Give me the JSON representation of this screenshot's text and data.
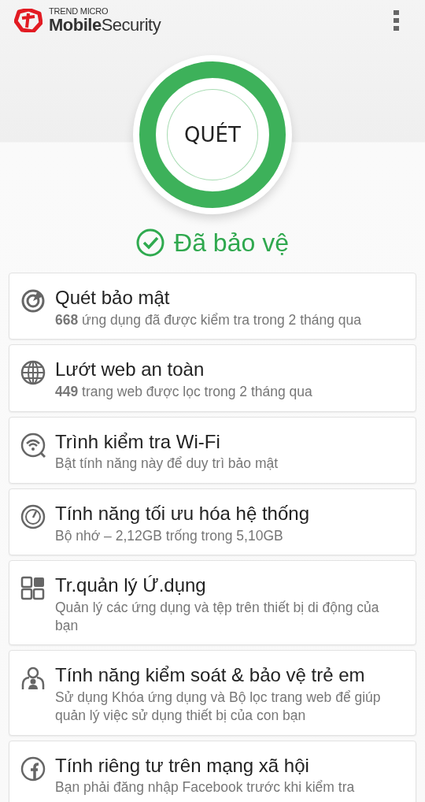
{
  "header": {
    "brand": "TREND MICRO",
    "product": "**Mobile**Security"
  },
  "scan_button": {
    "label": "QUÉT"
  },
  "status": {
    "text": "Đã bảo vệ",
    "protected": true
  },
  "features": [
    {
      "kind": "radar",
      "title": "Quét bảo mật",
      "description": "**668** ứng dụng đã được kiểm tra trong 2 tháng qua"
    },
    {
      "kind": "globe",
      "title": "Lướt web an toàn",
      "description": "**449** trang web được lọc trong 2 tháng qua"
    },
    {
      "kind": "wifi",
      "title": "Trình kiểm tra Wi-Fi",
      "description": "Bật tính năng này để duy trì bảo mật"
    },
    {
      "kind": "gauge",
      "title": "Tính năng tối ưu hóa hệ thống",
      "description": "Bộ nhớ – 2,12GB trống trong 5,10GB"
    },
    {
      "kind": "apps",
      "title": "Tr.quản lý Ứ.dụng",
      "description": "Quản lý các ứng dụng và tệp trên thiết bị di động của bạn"
    },
    {
      "kind": "child",
      "title": "Tính năng kiểm soát & bảo vệ trẻ em",
      "description": "Sử dụng Khóa ứng dụng và Bộ lọc trang web để giúp quản lý việc sử dụng thiết bị của con bạn"
    },
    {
      "kind": "facebook",
      "title": "Tính riêng tư trên mạng xã hội",
      "description": "Bạn phải đăng nhập Facebook trước khi kiểm tra"
    }
  ]
}
